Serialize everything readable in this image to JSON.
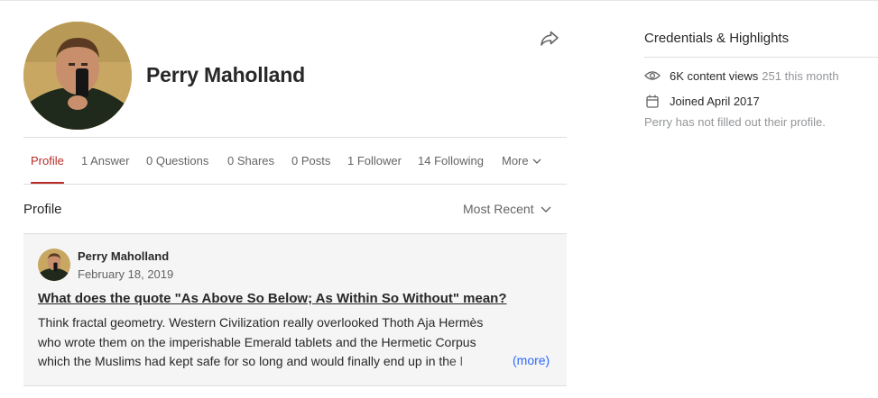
{
  "profile": {
    "name": "Perry Maholland"
  },
  "tabs": [
    {
      "label": "Profile",
      "active": true
    },
    {
      "label": "1 Answer"
    },
    {
      "label": "0 Questions"
    },
    {
      "label": "0 Shares"
    },
    {
      "label": "0 Posts"
    },
    {
      "label": "1 Follower"
    },
    {
      "label": "14 Following"
    },
    {
      "label": "More"
    }
  ],
  "section": {
    "title": "Profile",
    "sort_label": "Most Recent"
  },
  "feed": [
    {
      "author": "Perry Maholland",
      "date": "February 18, 2019",
      "question": "What does the quote \"As Above So Below; As Within So Without\" mean?",
      "excerpt_lines": [
        "Think fractal geometry. Western Civilization really overlooked Thoth Aja Hermès",
        "who wrote them on the imperishable Emerald tablets and the Hermetic Corpus",
        "which the Muslims had kept safe for so long and would finally end up in the l"
      ],
      "more_label": "(more)"
    }
  ],
  "sidebar": {
    "title": "Credentials & Highlights",
    "views_label": "6K content views",
    "views_month": "251 this month",
    "joined": "Joined April 2017",
    "empty_note": "Perry has not filled out their profile."
  },
  "colors": {
    "accent": "#b92b27",
    "link": "#2e69ff",
    "muted": "#636466",
    "card_bg": "#f5f5f5"
  },
  "icons": [
    "share-arrow-icon",
    "chevron-down-icon",
    "eye-icon",
    "calendar-icon"
  ]
}
